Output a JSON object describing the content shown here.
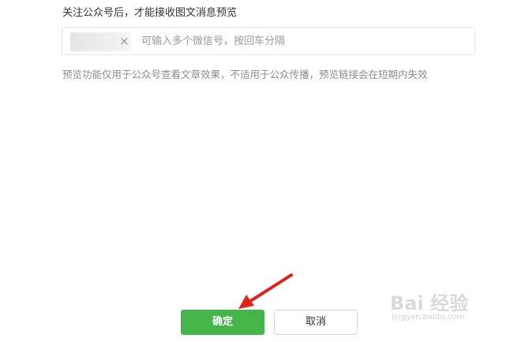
{
  "dialog": {
    "instruction": "关注公众号后，才能接收图文消息预览",
    "wechat_input": {
      "placeholder": "可输入多个微信号，按回车分隔",
      "tag_remove_symbol": "×"
    },
    "hint": "预览功能仅用于公众号查看文章效果，不适用于公众传播，预览链接会在短期内失效",
    "confirm_label": "确定",
    "cancel_label": "取消"
  },
  "watermark": {
    "logo_text": "Bai 经验",
    "url": "jingyan.baidu.com"
  },
  "colors": {
    "primary": "#44b549",
    "annotation_arrow": "#e3211b",
    "hint_text": "#8d8d8d"
  }
}
